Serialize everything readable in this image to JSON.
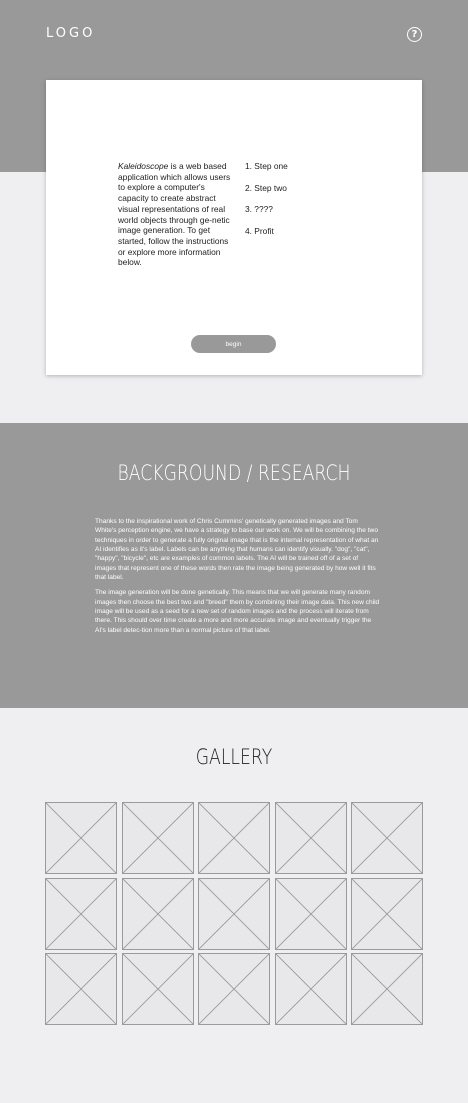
{
  "header": {
    "logo": "LOGO",
    "help_icon": "question-circle-icon",
    "help_glyph": "?"
  },
  "intro": {
    "title_italic": "Kaleidoscope",
    "description": " is a web based application which allows users to explore a computer's capacity to create abstract visual representations of real world objects through ge-netic image generation. To get started, follow the instructions or explore more information below.",
    "steps": [
      "1. Step one",
      "2. Step two",
      "3. ????",
      "4. Profit"
    ],
    "begin_label": "begin"
  },
  "research": {
    "title": "BACKGROUND / RESEARCH",
    "paragraphs": [
      "Thanks to the inspirational work of Chris Cummins' genetically generated images and Tom White's perception engine, we have a strategy to base our work on. We will be combining the two techniques in order to generate a fully original image that is the internal representation of what an AI identifies as it's label. Labels can be anything that humans can identify visually. \"dog\", \"cat\", \"happy\", \"bicycle\", etc are examples of common labels. The AI will be trained off of a set of images that represent one of these words then rate the image being generated by how well it fits that label.",
      "The image generation will be done genetically. This means that we will generate many random images then choose the best two and \"breed\" them by combining their image data. This new child image will be used as a seed for a new set of random images and the process will iterate from there. This should over time create a more and more accurate image and eventually trigger the AI's label detec-tion more than a normal picture of that label."
    ]
  },
  "gallery": {
    "title": "GALLERY",
    "placeholder_icon": "image-placeholder-icon",
    "item_count": 15
  },
  "colors": {
    "band": "#999999",
    "page": "#efeff1",
    "card": "#ffffff",
    "thumb_fill": "#e8e8ea",
    "thumb_stroke": "#9a9a9a"
  }
}
